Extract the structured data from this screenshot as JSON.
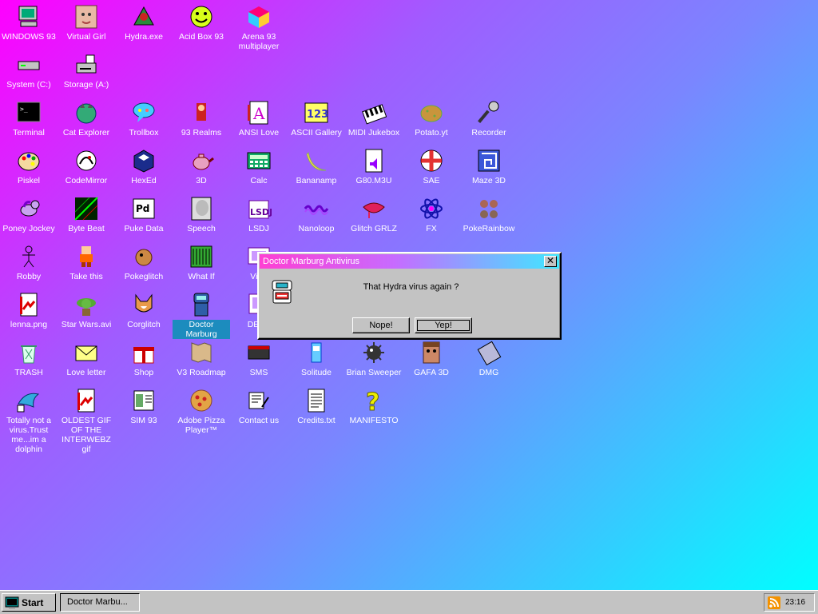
{
  "desktop": {
    "icons": [
      {
        "label": "WINDOWS 93",
        "icon": "computer-icon"
      },
      {
        "label": "Virtual Girl",
        "icon": "face-icon"
      },
      {
        "label": "Hydra.exe",
        "icon": "hydra-icon"
      },
      {
        "label": "Acid Box 93",
        "icon": "smiley-icon"
      },
      {
        "label": "Arena 93 multiplayer",
        "icon": "cube-icon"
      },
      {
        "label": "System (C:)",
        "icon": "drive-icon"
      },
      {
        "label": "Storage (A:)",
        "icon": "floppy-drive-icon"
      },
      {
        "label": "Terminal",
        "icon": "terminal-icon"
      },
      {
        "label": "Cat Explorer",
        "icon": "globe-cat-icon"
      },
      {
        "label": "Trollbox",
        "icon": "chat-bubble-icon"
      },
      {
        "label": "93 Realms",
        "icon": "knight-icon"
      },
      {
        "label": "ANSI Love",
        "icon": "letter-a-icon"
      },
      {
        "label": "ASCII Gallery",
        "icon": "numbers-icon"
      },
      {
        "label": "MIDI Jukebox",
        "icon": "piano-icon"
      },
      {
        "label": "Potato.yt",
        "icon": "potato-icon"
      },
      {
        "label": "Recorder",
        "icon": "microphone-icon"
      },
      {
        "label": "Piskel",
        "icon": "palette-icon"
      },
      {
        "label": "CodeMirror",
        "icon": "code-icon"
      },
      {
        "label": "HexEd",
        "icon": "hex-cube-icon"
      },
      {
        "label": "3D",
        "icon": "teapot-icon"
      },
      {
        "label": "Calc",
        "icon": "calculator-icon"
      },
      {
        "label": "Bananamp",
        "icon": "banana-icon"
      },
      {
        "label": "G80.M3U",
        "icon": "audio-file-icon"
      },
      {
        "label": "SAE",
        "icon": "ball-icon"
      },
      {
        "label": "Maze 3D",
        "icon": "maze-icon"
      },
      {
        "label": "Poney Jockey",
        "icon": "pony-icon"
      },
      {
        "label": "Byte Beat",
        "icon": "waveform-icon"
      },
      {
        "label": "Puke Data",
        "icon": "puredata-icon"
      },
      {
        "label": "Speech",
        "icon": "speech-face-icon"
      },
      {
        "label": "LSDJ",
        "icon": "lsdj-icon"
      },
      {
        "label": "Nanoloop",
        "icon": "nanoloop-icon"
      },
      {
        "label": "Glitch GRLZ",
        "icon": "lips-icon"
      },
      {
        "label": "FX",
        "icon": "atom-icon"
      },
      {
        "label": "PokeRainbow",
        "icon": "pokerainbow-icon"
      },
      {
        "label": "Robby",
        "icon": "stickman-icon"
      },
      {
        "label": "Take this",
        "icon": "pixel-man-icon"
      },
      {
        "label": "Pokeglitch",
        "icon": "pokeglitch-icon"
      },
      {
        "label": "What If",
        "icon": "whatif-icon"
      },
      {
        "label": "Virtu",
        "icon": "virtual-pc-icon"
      },
      {
        "label": "lenna.png",
        "icon": "image-file-icon"
      },
      {
        "label": "Star Wars.avi",
        "icon": "yoda-icon"
      },
      {
        "label": "Corglitch",
        "icon": "corgi-icon"
      },
      {
        "label": "Doctor Marburg",
        "icon": "doctor-icon"
      },
      {
        "label": "DEPS",
        "icon": "deps-icon"
      },
      {
        "label": "TRASH",
        "icon": "trash-icon"
      },
      {
        "label": "Love letter",
        "icon": "envelope-icon"
      },
      {
        "label": "Shop",
        "icon": "gift-icon"
      },
      {
        "label": "V3 Roadmap",
        "icon": "map-icon"
      },
      {
        "label": "SMS",
        "icon": "console-icon"
      },
      {
        "label": "Solitude",
        "icon": "solitude-icon"
      },
      {
        "label": "Brian Sweeper",
        "icon": "mine-icon"
      },
      {
        "label": "GAFA 3D",
        "icon": "doom-face-icon"
      },
      {
        "label": "DMG",
        "icon": "gameboy-icon"
      },
      {
        "label": "Totally not a virus.Trust me...im a dolphin",
        "icon": "dolphin-icon"
      },
      {
        "label": "OLDEST GIF OF THE INTERWEBZ gif",
        "icon": "gif-file-icon"
      },
      {
        "label": "SIM 93",
        "icon": "sim-book-icon"
      },
      {
        "label": "Adobe Pizza Player™",
        "icon": "pizza-icon"
      },
      {
        "label": "Contact us",
        "icon": "contact-icon"
      },
      {
        "label": "Credits.txt",
        "icon": "text-file-icon"
      },
      {
        "label": "MANIFESTO",
        "icon": "question-icon"
      }
    ]
  },
  "dialog": {
    "title": "Doctor Marburg Antivirus",
    "close_label": "✕",
    "message": "That Hydra virus again ?",
    "buttons": {
      "no": "Nope!",
      "yes": "Yep!"
    }
  },
  "taskbar": {
    "start_label": "Start",
    "task_label": "Doctor Marbu...",
    "clock": "23:16"
  },
  "colors": {
    "gradient_start": "#ff00ff",
    "gradient_end": "#00ffff",
    "window_face": "#c3c3c3",
    "selection": "#1c8cbe"
  }
}
